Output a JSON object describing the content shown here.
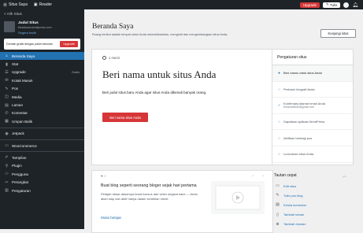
{
  "topbar": {
    "sites_label": "Situs Saya",
    "reader_label": "Reader",
    "upgrade_label": "Upgrade",
    "write_label": "Tulis"
  },
  "sidebar": {
    "back_label": "< Alih Situs",
    "site_title": "Judul Situs",
    "site_url": "beasiswa.wordpress.com",
    "site_link": "Segera hadir",
    "promo_text": "Domain gratis dengan paket tahunan",
    "promo_button": "Upgrade",
    "items": [
      {
        "label": "Beranda Saya",
        "icon": "⌂"
      },
      {
        "label": "Stat",
        "icon": "▮"
      },
      {
        "label": "Upgrade",
        "icon": "☰",
        "badge": "Gratis"
      },
      {
        "label": "Kotak Masuk",
        "icon": "✉"
      },
      {
        "label": "Pos",
        "icon": "✎"
      },
      {
        "label": "Media",
        "icon": "◫"
      },
      {
        "label": "Laman",
        "icon": "▤"
      },
      {
        "label": "Komentar",
        "icon": "✆"
      },
      {
        "label": "Umpan Balik",
        "icon": "▦"
      },
      {
        "label": "Jetpack",
        "icon": "◉"
      },
      {
        "label": "WooCommerce",
        "icon": "▭"
      },
      {
        "label": "Tampilan",
        "icon": "✐"
      },
      {
        "label": "Plugin",
        "icon": "⚲"
      },
      {
        "label": "Pengguna",
        "icon": "⚇"
      },
      {
        "label": "Perangkat",
        "icon": "✂"
      },
      {
        "label": "Pengaturan",
        "icon": "▥"
      }
    ]
  },
  "main": {
    "title": "Beranda Saya",
    "description": "Ruang berikut adalah tempat untuk Anda memublikasikan, mengedit dan mengembangkan situs Anda.",
    "visit_button": "Kunjungi situs",
    "timer": "1 menit",
    "heading": "Beri nama untuk situs Anda",
    "body": "Beri judul situs baru Anda agar situs Anda dikenali banyak orang.",
    "cta": "Beri nama situs Anda"
  },
  "checklist": {
    "title": "Pengaturan situs",
    "items": [
      {
        "label": "Beri nama untuk situs Anda",
        "current": true,
        "mark": "●"
      },
      {
        "label": "Perbarui biografi Anda",
        "mark": "○"
      },
      {
        "label": "Konfirmasi alamat email Anda",
        "sub": "tenunstudio83@gmail.com",
        "mark": "✓"
      },
      {
        "label": "Dapatkan aplikasi WordPress",
        "mark": "○"
      },
      {
        "label": "Aktifkan berbagi pos",
        "mark": "○"
      },
      {
        "label": "Luncurkan situs Anda",
        "mark": "○"
      }
    ]
  },
  "blog_card": {
    "dots": "● ○",
    "prev": "←",
    "next": "→",
    "heading": "Buat blog seperti seorang bloger sejak hari pertama",
    "body": "Pelajari dasar-dasarnya lewat kursus dan video singkat kami — Anda akan siap dan aktif hanya dalam sembilan menit.",
    "link": "Mulai belajar"
  },
  "quick_links": {
    "title": "Tautan cepat",
    "chevron": "︿",
    "items": [
      {
        "label": "Edit situs",
        "icon": "▭"
      },
      {
        "label": "Tulis pos blog",
        "icon": "✎"
      },
      {
        "label": "Kelola komentar",
        "icon": "▤"
      },
      {
        "label": "Tambah laman",
        "icon": "▯"
      },
      {
        "label": "Tambah domain",
        "icon": "⊕"
      }
    ]
  },
  "colors": {
    "sidebar_bg": "#1d2327",
    "active": "#2271b1",
    "accent_red": "#d63638"
  }
}
